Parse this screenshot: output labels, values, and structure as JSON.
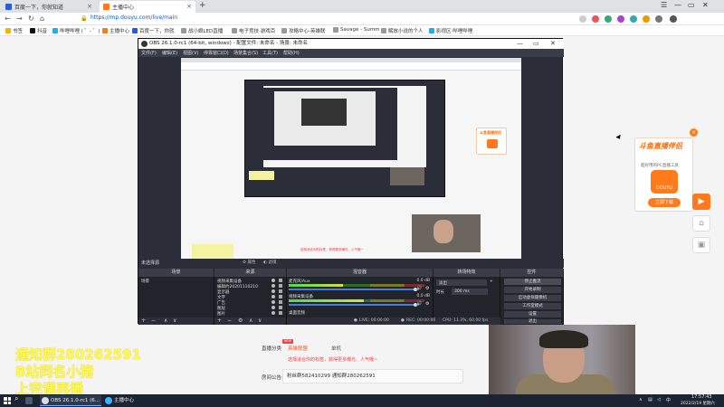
{
  "browser": {
    "tabs": [
      {
        "title": "百度一下，你就知道"
      },
      {
        "title": "主播中心",
        "active": true
      }
    ],
    "url": "https://mp.douyu.com/live/main",
    "bookmarks": [
      "书签",
      "抖音",
      "哔哩哔哩 ( ゜- ゜)",
      "主播中心",
      "百度一下，你就",
      "战小娘LED直播",
      "电子竞技·游戏百",
      "攻略中心-英雄联",
      "Savage - Summ",
      "解放小说的个人",
      "影视区·哔哩哔哩"
    ]
  },
  "promo": {
    "title": "斗鱼直播伴侣",
    "subtitle": "超好用的PC直播工具",
    "logo_text": "DOUYU",
    "button": "立即下载"
  },
  "obs": {
    "title": "OBS 26.1.0-rc1 (64-bit, windows) - 配置文件: 未命名 - 场景: 未命名",
    "menu": [
      "文件(F)",
      "编辑(E)",
      "视图(V)",
      "停靠窗口(D)",
      "场景集合(S)",
      "工具(T)",
      "帮助(H)"
    ],
    "scene_label": "未选择源",
    "props_btn": "属性",
    "filter_btn": "滤镜",
    "dock_headers": [
      "场景",
      "来源",
      "混音器",
      "转场特效",
      "控件"
    ],
    "scenes": [
      "场景"
    ],
    "sources": [
      "视频采集设备",
      "编辑约20201110210",
      "显示器",
      "文字",
      "广告",
      "图层",
      "图片"
    ],
    "mixer": [
      {
        "name": "麦克风/Aux",
        "db": "0.0 dB",
        "level": 0.4
      },
      {
        "name": "视频采集设备",
        "db": "0.0 dB",
        "level": 0.55
      }
    ],
    "mixer_footer": "桌面音频",
    "transition": {
      "type": "淡出",
      "duration_label": "时长",
      "duration": "300 ms"
    },
    "controls": [
      "停止推流",
      "开始录制",
      "启动虚拟摄像机",
      "工作室模式",
      "设置",
      "退出"
    ],
    "status": {
      "live": "LIVE: 00:00:00",
      "rec": "REC: 00:00:00",
      "cpu": "CPU: 11.3%, 60.00 fps"
    }
  },
  "page": {
    "type_label": "直播分类",
    "type_value": "英雄联盟",
    "type_alt": "单机",
    "new_badge": "NEW",
    "hint": "选择适合你的标签，获得更多曝光、人气哦~",
    "notice_label": "房间公告:",
    "notice_value": "粉丝群582410299 通知群280262591"
  },
  "overlay": {
    "line1": "通知群280262591",
    "line2": "B站同名小猪",
    "line3": "上完课再播"
  },
  "taskbar": {
    "apps": [
      "OBS 26.1.0-rc1 (6...",
      "主播中心"
    ],
    "time": "17:57:43",
    "date": "2022/2/19 星期六"
  }
}
